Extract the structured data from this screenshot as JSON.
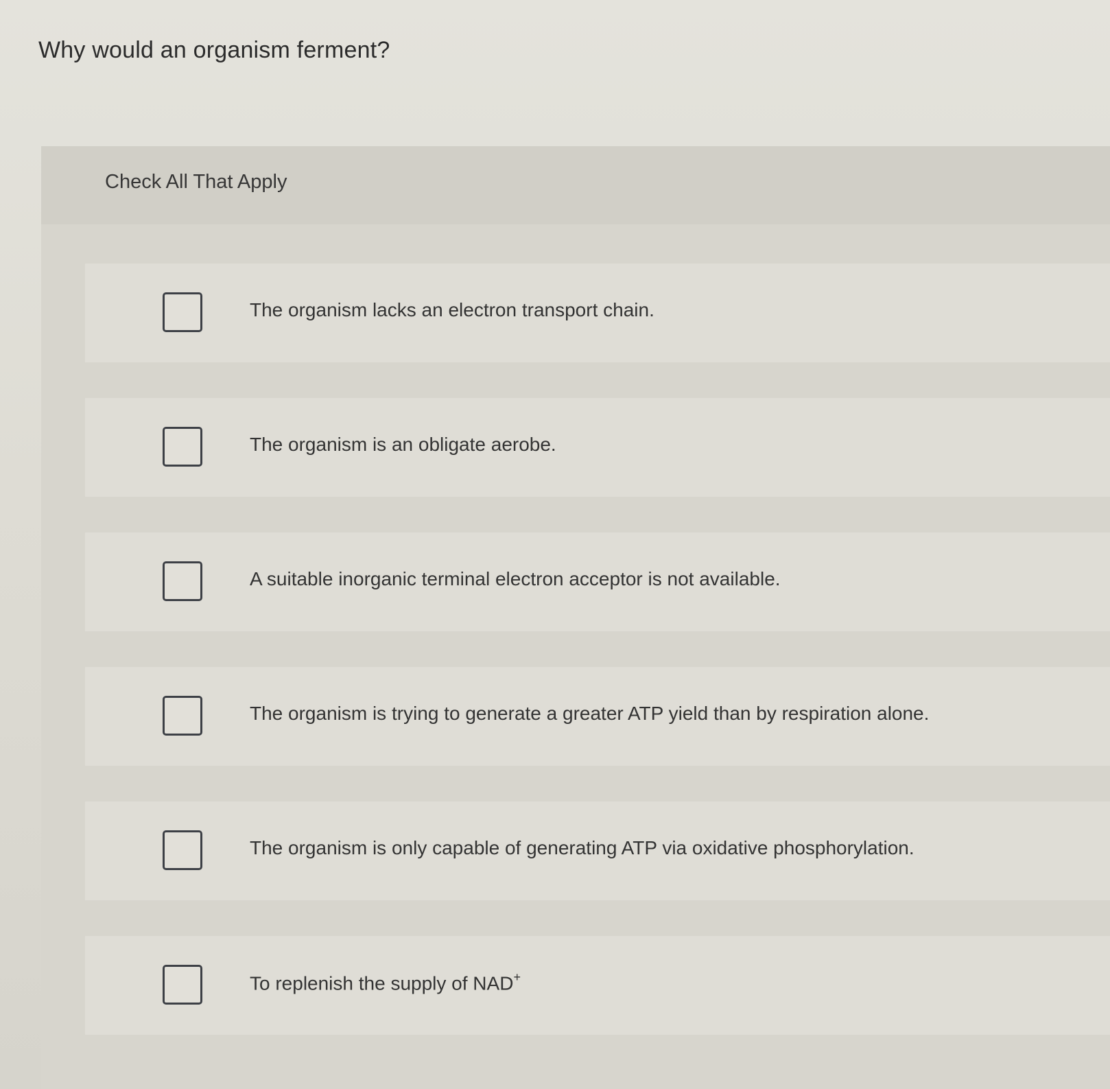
{
  "question": {
    "text": "Why would an organism ferment?"
  },
  "instruction": "Check All That Apply",
  "options": [
    {
      "label": "The organism lacks an electron transport chain.",
      "checked": false
    },
    {
      "label": "The organism is an obligate aerobe.",
      "checked": false
    },
    {
      "label": "A suitable inorganic terminal electron acceptor is not available.",
      "checked": false
    },
    {
      "label": "The organism is trying to generate a greater ATP yield than by respiration alone.",
      "checked": false
    },
    {
      "label": "The organism is only capable of generating ATP via oxidative phosphorylation.",
      "checked": false
    },
    {
      "label": "To replenish the supply of NAD",
      "superscript": "+",
      "checked": false
    }
  ]
}
